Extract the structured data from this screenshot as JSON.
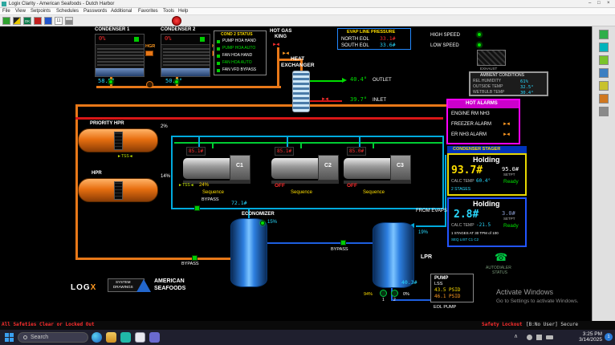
{
  "colors": {
    "alarm_red": "#ff2e2e",
    "ok_green": "#00e000",
    "value_cyan": "#29d9ff",
    "value_yellow": "#ffdf00",
    "pipe_orange": "#e87818",
    "pipe_red": "#d81616",
    "pipe_cyan": "#00aadd",
    "pipe_blue": "#1e5fe0",
    "alarm_magenta": "#ff4bff",
    "stager_yellow": "#e8d800",
    "stager_blue": "#2255ff"
  },
  "window": {
    "title": "Logix Clarity - American Seafoods - Dutch Harbor",
    "menu": [
      "File",
      "View",
      "Setpoints",
      "Schedules",
      "Passwords",
      "Additional",
      "Favorites",
      "Tools",
      "Help"
    ],
    "min": "–",
    "max": "□",
    "close": "×"
  },
  "toolbar": {
    "ok": "OK",
    "eleven": "11"
  },
  "condensers": {
    "c1": {
      "label": "CONDENSER 1",
      "pct": "0%",
      "hgr": "HGR",
      "temp": "58.5°"
    },
    "c2": {
      "label": "CONDENSER 2",
      "pct": "0%",
      "hgr": "HGR",
      "temp": "50.0°"
    }
  },
  "cond2_status": {
    "title": "COND 2 STATUS",
    "rows": [
      "PUMP HOA HAND",
      "PUMP HOA AUTO",
      "FAN HOA HAND",
      "FAN HOA AUTO",
      "FAN VFD BYPASS"
    ]
  },
  "hot_gas_king": {
    "line1": "HOT GAS",
    "line2": "KING"
  },
  "evap": {
    "title": "EVAP LINE PRESSURE",
    "north_label": "NORTH EOL",
    "north_value": "33.1#",
    "south_label": "SOUTH EOL",
    "south_value": "33.6#"
  },
  "speed": {
    "high": "HIGH SPEED",
    "low": "LOW SPEED",
    "exhaust": "EXHAUST"
  },
  "hx": {
    "line1": "HEAT",
    "line2": "EXCHANGER",
    "outlet_value": "40.4°",
    "outlet_label": "OUTLET",
    "inlet_value": "39.7°",
    "inlet_label": "INLET"
  },
  "ambient": {
    "title": "AMBIENT CONDITIONS",
    "rows": [
      {
        "label": "REL HUMIDITY",
        "value": "61%"
      },
      {
        "label": "OUTSIDE TEMP",
        "value": "32.5°"
      },
      {
        "label": "WETBULB TEMP",
        "value": "30.4°"
      }
    ]
  },
  "hot_alarms": {
    "title": "HOT ALARMS",
    "rows": [
      "ENGINE RM NH3",
      "FREEZER ALARM",
      "ER NH3 ALARM"
    ]
  },
  "condenser_stager": {
    "title": "CONDENSER STAGER",
    "state": "Holding",
    "value": "93.7#",
    "setpoint": "95.0#",
    "setpt_label": "SETPT",
    "calc_label": "CALC TEMP",
    "calc_value": "60.4°",
    "ready": "Ready",
    "stages": "2 STAGES"
  },
  "compressor_stager": {
    "state": "Holding",
    "value": "2.8#",
    "setpoint": "3.0#",
    "setpt_label": "SETPT",
    "calc_label": "CALC TEMP",
    "calc_value": "-21.5",
    "ready": "Ready",
    "stages": "1 STAGES AT 30 TPM of 100",
    "seq": "SEQ LIST C1 C2"
  },
  "vessels": {
    "priority_hpr": {
      "label": "PRIORITY HPR",
      "level": "2%",
      "tss": "►TSS◄"
    },
    "hpr": {
      "label": "HPR",
      "level": "14%"
    },
    "economizer": {
      "label": "ECONOMIZER",
      "level": "15%",
      "pressure": "72.1#"
    },
    "lpr": {
      "label": "LPR",
      "level": "19%",
      "pressure": "40.3#",
      "from_evaps": "FROM EVAPS",
      "pump1": "1",
      "pump2": "2",
      "pump_pct": "94%",
      "valve_pct": "0%"
    }
  },
  "compressors": {
    "c1": {
      "label": "C1",
      "display": "85.1#",
      "tss": "►TSS◄",
      "pct": "24%",
      "mode": "Sequence"
    },
    "c2": {
      "label": "C2",
      "display": "85.1#",
      "status": "OFF",
      "mode": "Sequence"
    },
    "c3": {
      "label": "C3",
      "display": "85.0#",
      "status": "OFF",
      "mode": "Sequence"
    }
  },
  "bypass": {
    "label": "BYPASS"
  },
  "pump_lss": {
    "title": "PUMP",
    "sub": "LSS",
    "v1": "43.5 PSID",
    "v2": "46.1 PSID",
    "footer": "EOL PUMP"
  },
  "autodialer": {
    "line1": "AUTODIALER",
    "line2": "STATUS"
  },
  "branding": {
    "logix_a": "LOG",
    "logix_b": "X",
    "drawings1": "SYSTEM",
    "drawings2": "DRAWINGS",
    "american": "AMERICAN",
    "seafoods": "SEAFOODS"
  },
  "activate": {
    "line1": "Activate Windows",
    "line2": "Go to Settings to activate Windows."
  },
  "statusbar": {
    "left": "All Safeties Clear or Locked Out",
    "right1": "Safety Lockout",
    "right2": "[B:No User] Secure"
  },
  "taskbar": {
    "search": "Search",
    "tray_arrow": "∧",
    "time": "3:25 PM",
    "date": "3/14/2025",
    "badge": "1"
  }
}
